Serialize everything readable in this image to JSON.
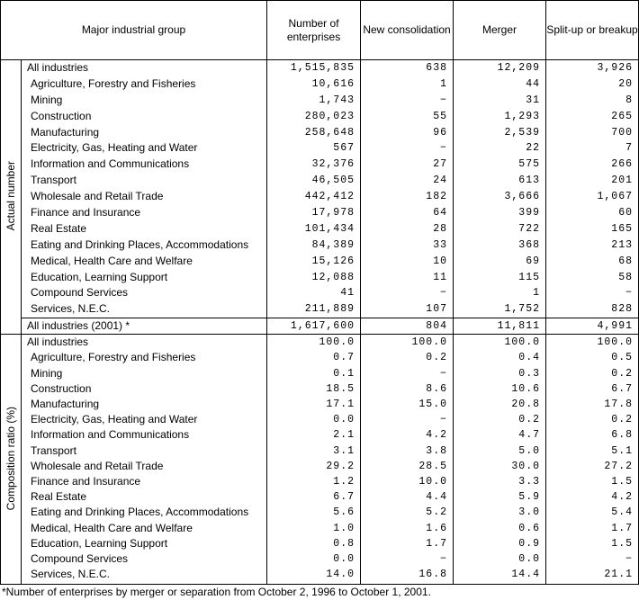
{
  "headers": {
    "group": "Major industrial group",
    "enterprises": "Number of enterprises",
    "new_consolidation": "New consolidation",
    "merger": "Merger",
    "splitup": "Split-up or breakup"
  },
  "sections": {
    "actual": {
      "label": "Actual number",
      "rows": [
        {
          "name": "All industries",
          "enterprises": "1,515,835",
          "new": "638",
          "merger": "12,209",
          "split": "3,926"
        },
        {
          "name": "Agriculture, Forestry and Fisheries",
          "enterprises": "10,616",
          "new": "1",
          "merger": "44",
          "split": "20"
        },
        {
          "name": "Mining",
          "enterprises": "1,743",
          "new": "−",
          "merger": "31",
          "split": "8"
        },
        {
          "name": "Construction",
          "enterprises": "280,023",
          "new": "55",
          "merger": "1,293",
          "split": "265"
        },
        {
          "name": "Manufacturing",
          "enterprises": "258,648",
          "new": "96",
          "merger": "2,539",
          "split": "700"
        },
        {
          "name": "Electricity, Gas, Heating and Water",
          "enterprises": "567",
          "new": "−",
          "merger": "22",
          "split": "7"
        },
        {
          "name": "Information and Communications",
          "enterprises": "32,376",
          "new": "27",
          "merger": "575",
          "split": "266"
        },
        {
          "name": "Transport",
          "enterprises": "46,505",
          "new": "24",
          "merger": "613",
          "split": "201"
        },
        {
          "name": "Wholesale and Retail Trade",
          "enterprises": "442,412",
          "new": "182",
          "merger": "3,666",
          "split": "1,067"
        },
        {
          "name": "Finance and Insurance",
          "enterprises": "17,978",
          "new": "64",
          "merger": "399",
          "split": "60"
        },
        {
          "name": "Real Estate",
          "enterprises": "101,434",
          "new": "28",
          "merger": "722",
          "split": "165"
        },
        {
          "name": "Eating and Drinking Places, Accommodations",
          "enterprises": "84,389",
          "new": "33",
          "merger": "368",
          "split": "213"
        },
        {
          "name": "Medical, Health Care and Welfare",
          "enterprises": "15,126",
          "new": "10",
          "merger": "69",
          "split": "68"
        },
        {
          "name": "Education, Learning Support",
          "enterprises": "12,088",
          "new": "11",
          "merger": "115",
          "split": "58"
        },
        {
          "name": "Compound Services",
          "enterprises": "41",
          "new": "−",
          "merger": "1",
          "split": "−"
        },
        {
          "name": "Services, N.E.C.",
          "enterprises": "211,889",
          "new": "107",
          "merger": "1,752",
          "split": "828"
        }
      ],
      "total": {
        "name": "All industries (2001) *",
        "enterprises": "1,617,600",
        "new": "804",
        "merger": "11,811",
        "split": "4,991"
      }
    },
    "ratio": {
      "label": "Composition ratio (%)",
      "rows": [
        {
          "name": "All industries",
          "enterprises": "100.0",
          "new": "100.0",
          "merger": "100.0",
          "split": "100.0"
        },
        {
          "name": "Agriculture, Forestry and Fisheries",
          "enterprises": "0.7",
          "new": "0.2",
          "merger": "0.4",
          "split": "0.5"
        },
        {
          "name": "Mining",
          "enterprises": "0.1",
          "new": "−",
          "merger": "0.3",
          "split": "0.2"
        },
        {
          "name": "Construction",
          "enterprises": "18.5",
          "new": "8.6",
          "merger": "10.6",
          "split": "6.7"
        },
        {
          "name": "Manufacturing",
          "enterprises": "17.1",
          "new": "15.0",
          "merger": "20.8",
          "split": "17.8"
        },
        {
          "name": "Electricity, Gas, Heating and Water",
          "enterprises": "0.0",
          "new": "−",
          "merger": "0.2",
          "split": "0.2"
        },
        {
          "name": "Information and Communications",
          "enterprises": "2.1",
          "new": "4.2",
          "merger": "4.7",
          "split": "6.8"
        },
        {
          "name": "Transport",
          "enterprises": "3.1",
          "new": "3.8",
          "merger": "5.0",
          "split": "5.1"
        },
        {
          "name": "Wholesale and Retail Trade",
          "enterprises": "29.2",
          "new": "28.5",
          "merger": "30.0",
          "split": "27.2"
        },
        {
          "name": "Finance and Insurance",
          "enterprises": "1.2",
          "new": "10.0",
          "merger": "3.3",
          "split": "1.5"
        },
        {
          "name": "Real Estate",
          "enterprises": "6.7",
          "new": "4.4",
          "merger": "5.9",
          "split": "4.2"
        },
        {
          "name": "Eating and Drinking Places, Accommodations",
          "enterprises": "5.6",
          "new": "5.2",
          "merger": "3.0",
          "split": "5.4"
        },
        {
          "name": "Medical, Health Care and Welfare",
          "enterprises": "1.0",
          "new": "1.6",
          "merger": "0.6",
          "split": "1.7"
        },
        {
          "name": "Education, Learning Support",
          "enterprises": "0.8",
          "new": "1.7",
          "merger": "0.9",
          "split": "1.5"
        },
        {
          "name": "Compound Services",
          "enterprises": "0.0",
          "new": "−",
          "merger": "0.0",
          "split": "−"
        },
        {
          "name": "Services, N.E.C.",
          "enterprises": "14.0",
          "new": "16.8",
          "merger": "14.4",
          "split": "21.1"
        }
      ]
    }
  },
  "footnote": "*Number of enterprises by merger or separation from October 2, 1996 to October 1, 2001."
}
